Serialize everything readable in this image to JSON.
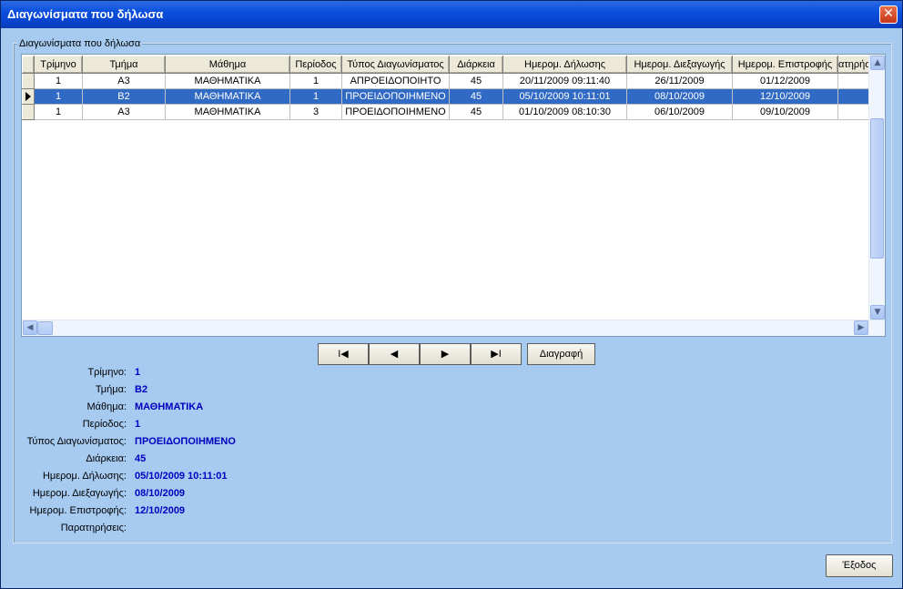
{
  "window": {
    "title": "Διαγωνίσματα που δήλωσα",
    "close_glyph": "✕"
  },
  "group": {
    "title": "Διαγωνίσματα που δήλωσα"
  },
  "table": {
    "columns": [
      "Τρίμηνο",
      "Τμήμα",
      "Μάθημα",
      "Περίοδος",
      "Τύπος Διαγωνίσματος",
      "Διάρκεια",
      "Ημερομ. Δήλωσης",
      "Ημερομ. Διεξαγωγής",
      "Ημερομ. Επιστροφής",
      "ατηρήσ"
    ],
    "rows": [
      [
        "1",
        "Α3",
        "ΜΑΘΗΜΑΤΙΚΑ",
        "1",
        "ΑΠΡΟΕΙΔΟΠΟΙΗΤΟ",
        "45",
        "20/11/2009 09:11:40",
        "26/11/2009",
        "01/12/2009",
        ""
      ],
      [
        "1",
        "Β2",
        "ΜΑΘΗΜΑΤΙΚΑ",
        "1",
        "ΠΡΟΕΙΔΟΠΟΙΗΜΕΝΟ",
        "45",
        "05/10/2009 10:11:01",
        "08/10/2009",
        "12/10/2009",
        ""
      ],
      [
        "1",
        "Α3",
        "ΜΑΘΗΜΑΤΙΚΑ",
        "3",
        "ΠΡΟΕΙΔΟΠΟΙΗΜΕΝΟ",
        "45",
        "01/10/2009 08:10:30",
        "06/10/2009",
        "09/10/2009",
        ""
      ]
    ],
    "selected_row": 1
  },
  "nav": {
    "first": "I◀",
    "prev": "◀",
    "next": "▶",
    "last": "▶I",
    "delete": "Διαγραφή"
  },
  "details": [
    {
      "label": "Τρίμηνο:",
      "value": "1"
    },
    {
      "label": "Τμήμα:",
      "value": "Β2"
    },
    {
      "label": "Μάθημα:",
      "value": "ΜΑΘΗΜΑΤΙΚΑ"
    },
    {
      "label": "Περίοδος:",
      "value": "1"
    },
    {
      "label": "Τύπος Διαγωνίσματος:",
      "value": "ΠΡΟΕΙΔΟΠΟΙΗΜΕΝΟ"
    },
    {
      "label": "Διάρκεια:",
      "value": "45"
    },
    {
      "label": "Ημερομ. Δήλωσης:",
      "value": "05/10/2009 10:11:01"
    },
    {
      "label": "Ημερομ. Διεξαγωγής:",
      "value": "08/10/2009"
    },
    {
      "label": "Ημερομ. Επιστροφής:",
      "value": "12/10/2009"
    },
    {
      "label": "Παρατηρήσεις:",
      "value": ""
    }
  ],
  "footer": {
    "exit_label": "Έξοδος"
  },
  "colors": {
    "title_bar": "#0b4fdc",
    "background": "#a6caf0",
    "selection": "#316ac5",
    "value_text": "#0000c0"
  }
}
